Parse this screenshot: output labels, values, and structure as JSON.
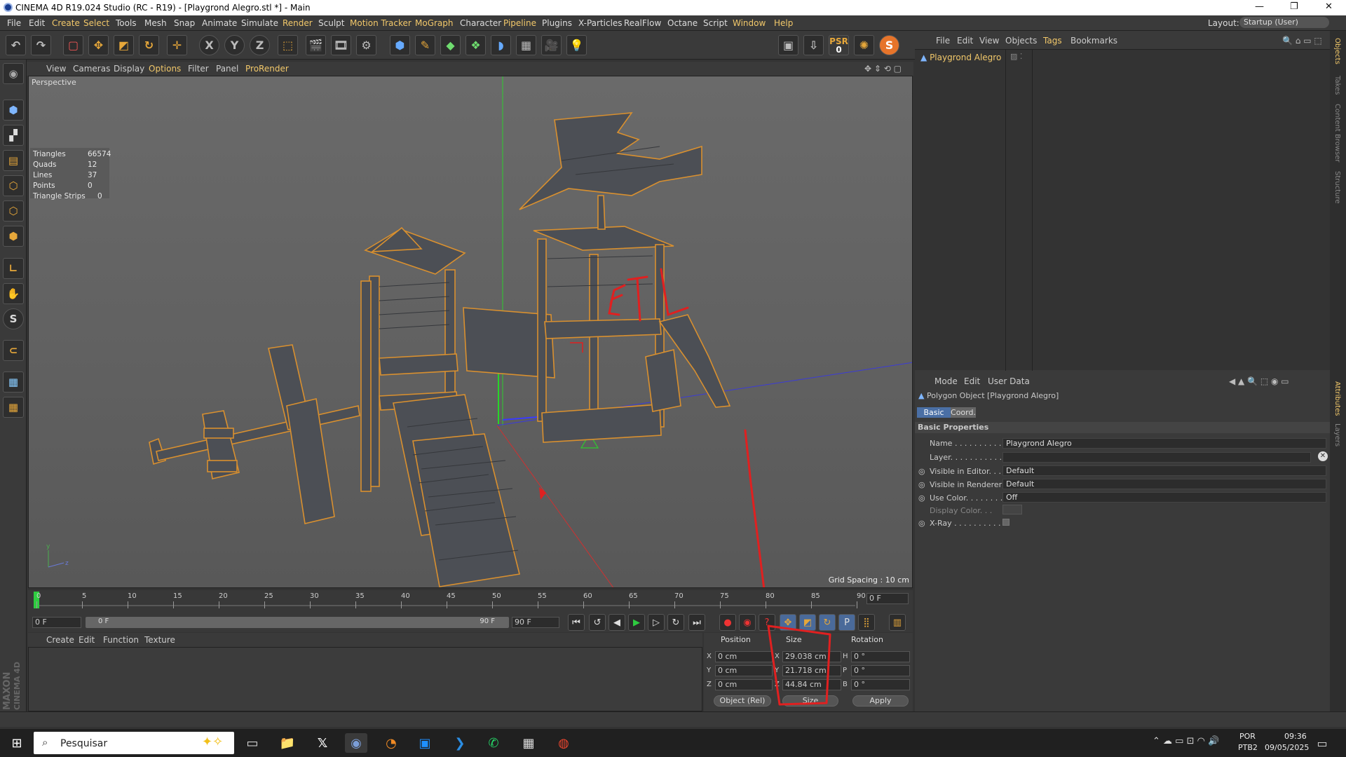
{
  "window": {
    "title": "CINEMA 4D R19.024 Studio (RC - R19) - [Playgrond Alegro.stl *] - Main"
  },
  "menu": [
    "File",
    "Edit",
    "Create",
    "Select",
    "Tools",
    "Mesh",
    "Snap",
    "Animate",
    "Simulate",
    "Render",
    "Sculpt",
    "Motion Tracker",
    "MoGraph",
    "Character",
    "Pipeline",
    "Plugins",
    "X-Particles",
    "RealFlow",
    "Octane",
    "Script",
    "Window",
    "Help"
  ],
  "layout": {
    "label": "Layout:",
    "value": "Startup (User)"
  },
  "toolbar": {
    "psr_label": "PSR",
    "psr_value": "0",
    "x": "X",
    "y": "Y",
    "z": "Z"
  },
  "viewport_menu": [
    "View",
    "Cameras",
    "Display",
    "Options",
    "Filter",
    "Panel",
    "ProRender"
  ],
  "viewport": {
    "name": "Perspective",
    "grid_spacing": "Grid Spacing : 10 cm",
    "annotation": ".STL",
    "stats": [
      {
        "label": "Triangles",
        "value": "66574"
      },
      {
        "label": "Quads",
        "value": "12"
      },
      {
        "label": "Lines",
        "value": "37"
      },
      {
        "label": "Points",
        "value": "0"
      },
      {
        "label": "Triangle Strips",
        "value": "0"
      }
    ]
  },
  "timeline": {
    "ticks": [
      "0",
      "5",
      "10",
      "15",
      "20",
      "25",
      "30",
      "35",
      "40",
      "45",
      "50",
      "55",
      "60",
      "65",
      "70",
      "75",
      "80",
      "85",
      "90"
    ],
    "current": "0 F",
    "start": "0 F",
    "range_start": "0 F",
    "range_end": "90 F",
    "end": "90 F"
  },
  "material_menu": [
    "Create",
    "Edit",
    "Function",
    "Texture"
  ],
  "coords": {
    "headers": {
      "position": "Position",
      "size": "Size",
      "rotation": "Rotation"
    },
    "rows": [
      {
        "axis": "X",
        "pos": "0 cm",
        "size_axis": "X",
        "size": "29.038 cm",
        "rot_axis": "H",
        "rot": "0 °"
      },
      {
        "axis": "Y",
        "pos": "0 cm",
        "size_axis": "Y",
        "size": "21.718 cm",
        "rot_axis": "P",
        "rot": "0 °"
      },
      {
        "axis": "Z",
        "pos": "0 cm",
        "size_axis": "Z",
        "size": "44.84 cm",
        "rot_axis": "B",
        "rot": "0 °"
      }
    ],
    "mode": "Object (Rel)",
    "size_mode": "Size",
    "apply": "Apply"
  },
  "object_menu": [
    "File",
    "Edit",
    "View",
    "Objects",
    "Tags",
    "Bookmarks"
  ],
  "objects": [
    {
      "name": "Playgrond Alegro"
    }
  ],
  "attr_menu": [
    "Mode",
    "Edit",
    "User Data"
  ],
  "attributes": {
    "object_title": "Polygon Object [Playgrond Alegro]",
    "tabs": [
      "Basic",
      "Coord."
    ],
    "section": "Basic Properties",
    "props": [
      {
        "label": "Name . . . . . . . . . . .",
        "value": "Playgrond Alegro"
      },
      {
        "label": "Layer. . . . . . . . . . . .",
        "value": ""
      },
      {
        "label": "Visible in Editor. . .",
        "value": "Default"
      },
      {
        "label": "Visible in Renderer",
        "value": "Default"
      },
      {
        "label": "Use Color. . . . . . . .",
        "value": "Off"
      },
      {
        "label": "Display Color. . .",
        "value": ""
      },
      {
        "label": "X-Ray . . . . . . . . . .",
        "value": ""
      }
    ]
  },
  "side_tabs": [
    "Objects",
    "Takes",
    "Content Browser",
    "Structure",
    "Attributes",
    "Layers"
  ],
  "brand": {
    "line1": "MAXON",
    "line2": "CINEMA 4D"
  },
  "taskbar": {
    "search": "Pesquisar",
    "lang1": "POR",
    "lang2": "PTB2",
    "time": "09:36",
    "date": "09/05/2025"
  },
  "colors": {
    "accent": "#e6a73a",
    "highlight_menu": "#f2c86a",
    "annotation_red": "#e02020",
    "selection_outline": "#d9902f"
  }
}
